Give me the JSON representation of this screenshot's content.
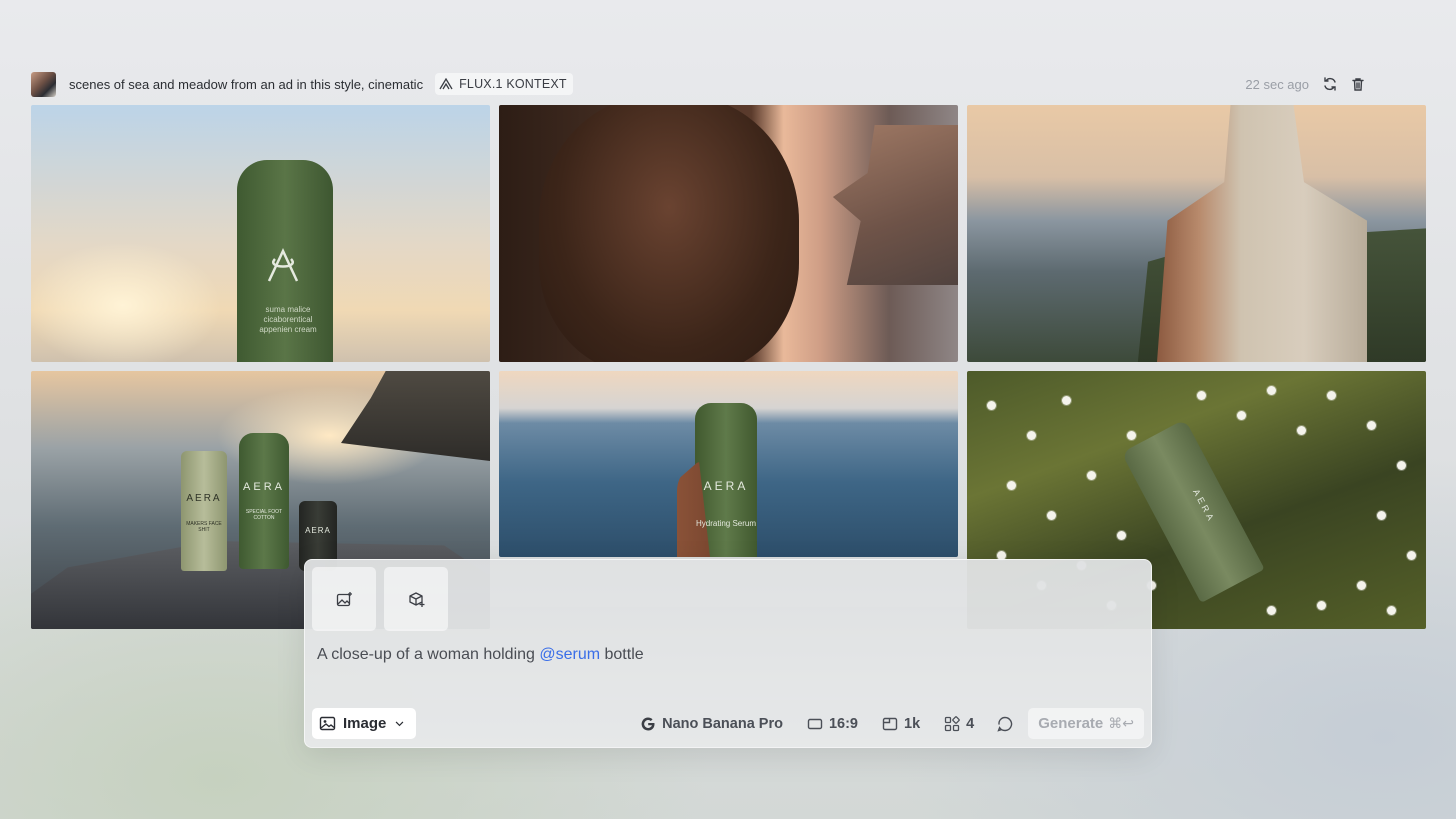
{
  "header": {
    "prompt": "scenes of sea and meadow from an ad in this style, cinematic",
    "model_badge": "FLUX.1 KONTEXT",
    "timestamp": "22 sec ago",
    "icons": [
      "regenerate-icon",
      "trash-icon"
    ]
  },
  "images": [
    {
      "id": "image-1",
      "bottle_text": "",
      "alt": ""
    },
    {
      "id": "image-2",
      "alt": ""
    },
    {
      "id": "image-3",
      "alt": ""
    },
    {
      "id": "image-4",
      "brand": "AERA"
    },
    {
      "id": "image-5",
      "brand": "AERA",
      "product": "Hydrating Serum"
    },
    {
      "id": "image-6",
      "brand": "AERA"
    }
  ],
  "tile1_text": {
    "line1": "suma malice",
    "line2": "cicaborentical",
    "line3": "appenien cream"
  },
  "tile4_text": {
    "b1": "AERA",
    "b2": "AERA",
    "b3": "AERA",
    "b1_sub": "MAKERS FACE SHIT",
    "b2_sub": "SPECIAL FOOT COTTON"
  },
  "tile5_text": {
    "brand": "AERA",
    "product": "Hydrating Serum"
  },
  "tile6_text": {
    "brand": "AERA"
  },
  "composer": {
    "prompt_prefix": "A close-up of a woman holding ",
    "mention": "@serum",
    "prompt_suffix": " bottle",
    "mode": "Image",
    "model": "Nano Banana Pro",
    "aspect_ratio": "16:9",
    "resolution": "1k",
    "count": "4",
    "generate_label": "Generate",
    "shortcut": "⌘↩"
  },
  "colors": {
    "mention": "#3a6ee8",
    "bottle_green": "#4f6a3e"
  }
}
